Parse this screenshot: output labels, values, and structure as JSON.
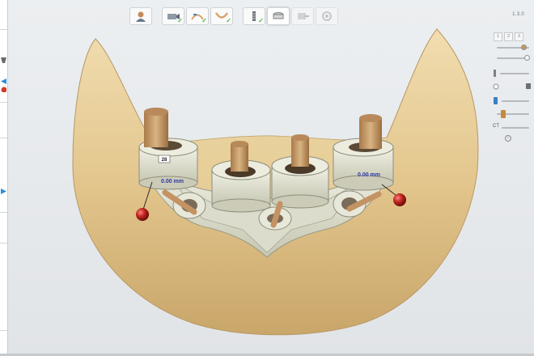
{
  "app": {
    "version_text": "1.3.0"
  },
  "toolbar": {
    "buttons": [
      {
        "name": "patient-button",
        "icon": "patient-icon",
        "state": "normal",
        "done": false
      },
      {
        "name": "step-scan-button",
        "icon": "scan-step-icon",
        "state": "normal",
        "done": true
      },
      {
        "name": "step-align-button",
        "icon": "align-step-icon",
        "state": "normal",
        "done": true
      },
      {
        "name": "step-bite-button",
        "icon": "bite-step-icon",
        "state": "normal",
        "done": true
      },
      {
        "name": "step-implant-button",
        "icon": "implant-step-icon",
        "state": "normal",
        "done": true
      },
      {
        "name": "step-abutment-button",
        "icon": "abutment-step-icon",
        "state": "active",
        "done": false
      },
      {
        "name": "step-export-button",
        "icon": "export-step-icon",
        "state": "disabled",
        "done": false
      },
      {
        "name": "step-settings-button",
        "icon": "gear-step-icon",
        "state": "disabled",
        "done": false
      }
    ]
  },
  "right_panel": {
    "tabs": [
      "1",
      "2",
      "3"
    ],
    "clip_label": "CT",
    "help_label": "?"
  },
  "scene": {
    "implant_labels": [
      {
        "tooth": "28",
        "measure": "0.00 mm"
      },
      {
        "tooth": "",
        "measure": "0.00 mm"
      }
    ]
  },
  "colors": {
    "bone": "#e6cc94",
    "guide": "#e2e2d2",
    "pin": "#c9a06c",
    "ball": "#b71c1c",
    "label": "#2f3aa8"
  }
}
